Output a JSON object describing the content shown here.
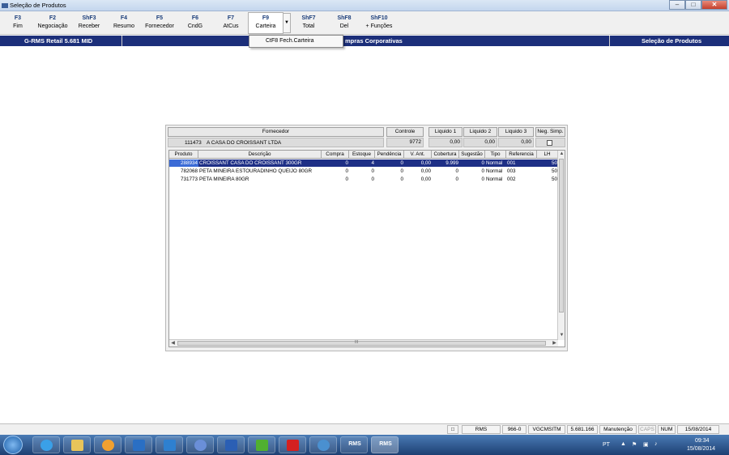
{
  "window": {
    "title": "Seleção de Produtos",
    "controls": [
      "–",
      "□",
      "✕"
    ]
  },
  "toolbar": [
    {
      "key": "F3",
      "label": "Fim"
    },
    {
      "key": "F2",
      "label": "Negociação"
    },
    {
      "key": "ShF3",
      "label": "Receber"
    },
    {
      "key": "F4",
      "label": "Resumo"
    },
    {
      "key": "F5",
      "label": "Fornecedor"
    },
    {
      "key": "F6",
      "label": "CndG"
    },
    {
      "key": "F7",
      "label": "AtCus"
    },
    {
      "key": "F9",
      "label": "Carteira"
    },
    {
      "key": "ShF7",
      "label": "Total"
    },
    {
      "key": "ShF8",
      "label": "Del"
    },
    {
      "key": "ShF10",
      "label": "+ Funções"
    }
  ],
  "dropdown": {
    "item": "CtF8  Fech.Carteira"
  },
  "header_bar": {
    "left": "G-RMS Retail 5.681 MID",
    "center": "mpras Corporativas",
    "right": "Seleção de Produtos"
  },
  "supplier": {
    "labels": {
      "fornecedor": "Fornecedor",
      "controle": "Controle",
      "liq1": "Liquido 1",
      "liq2": "Liquido 2",
      "liq3": "Liquido 3",
      "neg": "Neg. Simp."
    },
    "code": "111473",
    "name": "A CASA DO CROISSANT LTDA",
    "controle": "9772",
    "liq1": "0,00",
    "liq2": "0,00",
    "liq3": "0,00"
  },
  "grid": {
    "columns": [
      "Produto",
      "Descrição",
      "Compra",
      "Estoque",
      "Pendência",
      "V. Ant.",
      "Cobertura",
      "Sugestão",
      "Tipo",
      "Referencia",
      "LH"
    ],
    "rows": [
      [
        "288934",
        "CROISSANT CASA DO CROISSANT 300GR",
        "0",
        "4",
        "0",
        "0,00",
        "9.999",
        "0",
        "Normal",
        "001",
        "50"
      ],
      [
        "782068",
        "PETA MINEIRA ESTOURADINHO QUEIJO 80GR",
        "0",
        "0",
        "0",
        "0,00",
        "0",
        "0",
        "Normal",
        "003",
        "50"
      ],
      [
        "731773",
        "PETA MINEIRA 80GR",
        "0",
        "0",
        "0",
        "0,00",
        "0",
        "0",
        "Normal",
        "002",
        "50"
      ]
    ],
    "scroll_center": "III"
  },
  "status": [
    "RMS",
    "966-0",
    "VGCMSITM",
    "5.681.166",
    "Manutenção",
    "CAPS",
    "NUM",
    "15/08/2014"
  ],
  "taskbar": {
    "apps": [
      "start-button",
      "internet-explorer",
      "file-explorer",
      "media-player",
      "outlook",
      "lync",
      "connection-app",
      "word",
      "installer",
      "acrobat",
      "network-app",
      "rms",
      "rms"
    ],
    "rms_label": "RMS",
    "lang": "PT",
    "time": "09:34",
    "date": "15/08/2014"
  },
  "colors": {
    "header_blue": "#1c2f7a",
    "selection": "#1e2f86",
    "key_blue": "#1a3d7a"
  }
}
